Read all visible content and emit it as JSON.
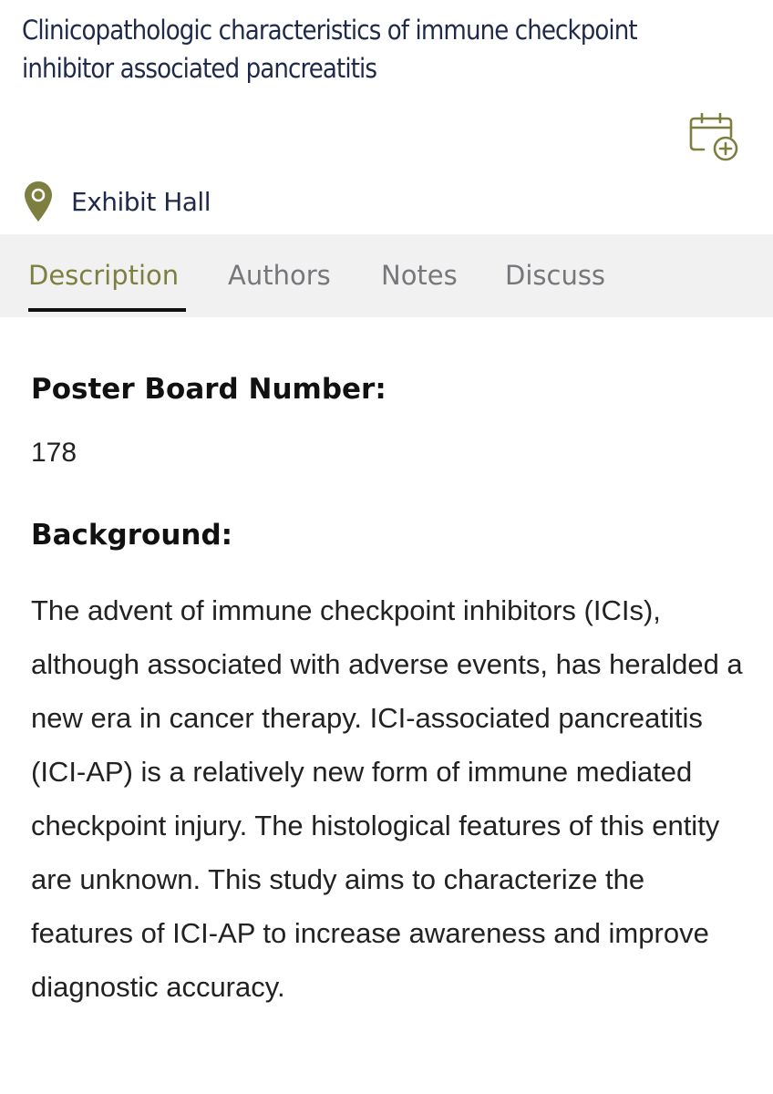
{
  "header": {
    "title": "Clinicopathologic characteristics of immune checkpoint inhibitor associated pancreatitis",
    "add_to_calendar_icon": "calendar-plus-icon"
  },
  "location": {
    "icon": "map-pin-icon",
    "label": "Exhibit Hall"
  },
  "tabs": [
    {
      "label": "Description",
      "active": true
    },
    {
      "label": "Authors",
      "active": false
    },
    {
      "label": "Notes",
      "active": false
    },
    {
      "label": "Discuss",
      "active": false
    }
  ],
  "content": {
    "poster_heading": "Poster Board Number:",
    "poster_number": "178",
    "background_heading": "Background:",
    "background_text": "The advent of immune checkpoint inhibitors (ICIs), although associated with adverse events, has heralded a new era in cancer therapy. ICI-associated pancreatitis (ICI-AP) is a relatively new form of immune mediated checkpoint injury. The histological features of this entity are unknown. This study aims to characterize the features of ICI-AP to increase awareness and improve diagnostic accuracy."
  },
  "colors": {
    "accent": "#7c7f3f",
    "title_text": "#1f2a4a",
    "tab_bar_background": "#f1f1f2",
    "inactive_tab": "#76777b",
    "active_indicator": "#111111"
  }
}
